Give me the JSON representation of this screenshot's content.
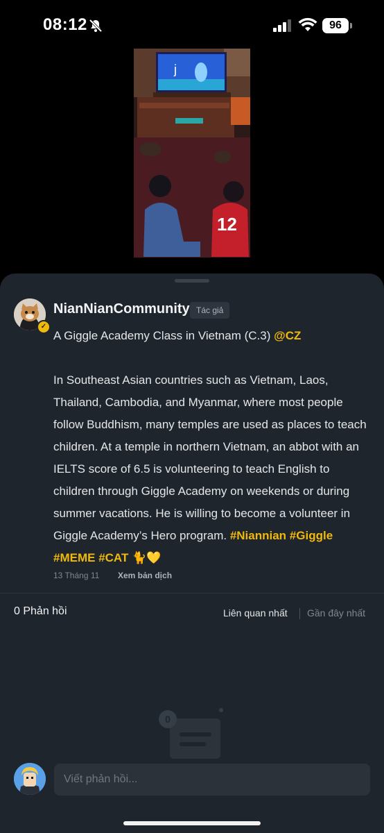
{
  "status_bar": {
    "time": "08:12",
    "battery": "96",
    "icons": [
      "bell-slash-icon",
      "signal-icon",
      "wifi-icon",
      "battery-icon"
    ]
  },
  "post": {
    "username": "NianNianCommunity",
    "author_badge": "Tác giả",
    "title": "A Giggle Academy Class in Vietnam (C.3)",
    "title_mention": "@CZ",
    "body": "In Southeast Asian countries such as Vietnam, Laos, Thailand, Cambodia, and Myanmar, where most people follow Buddhism, many temples are used as places to teach children. At a temple in northern Vietnam, an abbot with an IELTS score of 6.5 is volunteering to teach English to children through Giggle Academy on weekends or during summer vacations. He is willing to become a volunteer in Giggle Academy’s Hero program.",
    "hashtags": [
      "#Niannian",
      "#Giggle",
      "#MEME",
      "#CAT"
    ],
    "emoji": "🐈💛",
    "date": "13 Tháng 11",
    "translate_label": "Xem bản dịch"
  },
  "replies": {
    "count_label": "0 Phản hồi",
    "sort_relevant": "Liên quan nhất",
    "sort_recent": "Gần đây nhất",
    "empty_badge": "0"
  },
  "composer": {
    "placeholder": "Viết phản hồi..."
  },
  "colors": {
    "accent": "#f0b90b",
    "sheet_bg": "#1f252c",
    "input_bg": "#2b323a"
  }
}
